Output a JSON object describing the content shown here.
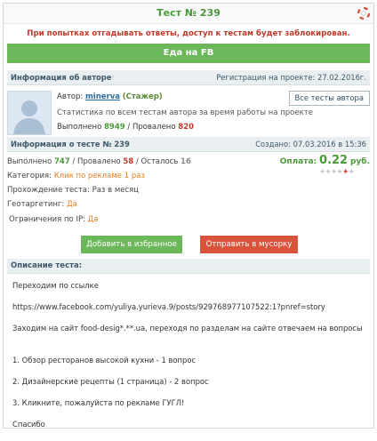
{
  "title": "Тест № 239",
  "warning": "При попытках отгадывать ответы, доступ к тестам будет заблокирован.",
  "fb_button": "Еда на FB",
  "author_section": {
    "label": "Информация об авторе",
    "reg_prefix": "Регистрация на проекте:",
    "reg_date": "27.02.2016г."
  },
  "author": {
    "prefix": "Автор:",
    "name": "minerva",
    "status": "(Стажер)",
    "all_tests_button": "Все тесты автора",
    "stats_text": "Статистика по всем тестам автора за время работы на проекте",
    "done_label": "Выполнено",
    "done_value": "8949",
    "sep": "/",
    "failed_label": "Провалено",
    "failed_value": "820"
  },
  "test_section": {
    "label": "Информация о тесте № 239",
    "created_prefix": "Создано:",
    "created_date": "07.03.2016 в 15:36"
  },
  "test": {
    "done_label": "Выполнено",
    "done_value": "747",
    "failed_label": "Провалено",
    "failed_value": "58",
    "left_label": "Осталось",
    "left_value": "16",
    "category_label": "Категория:",
    "category_value": "Клик по рекламе 1 раз",
    "pass_label": "Прохождение теста:",
    "pass_value": "Раз в месяц",
    "geo_label": "Геотаргетинг:",
    "geo_value": "Да",
    "ip_label": "Ограничения по IP:",
    "ip_value": "Да",
    "price_label": "Оплата:",
    "price_value": "0.22",
    "price_unit": "руб."
  },
  "actions": {
    "favorite": "Добавить в избранное",
    "trash": "Отправить в мусорку"
  },
  "description": {
    "label": "Описание теста:",
    "lines": [
      "Переходим по ссылке",
      "https://www.facebook.com/yuliya.yurieva.9/posts/929768977107522:1?pnref=story",
      "Заходим на сайт food-desig*.**.ua, переходя по разделам на сайте отвечаем на вопросы",
      "",
      "1. Обзор ресторанов высокой кухни - 1 вопрос",
      "2. Дизайнерские рецепты (1 страница) - 2 вопрос",
      "3. Кликните, пожалуйста по рекламе ГУГЛ!",
      "Спасибо"
    ]
  },
  "colors": {
    "accent_green": "#6bb85a",
    "danger_red": "#d9533b",
    "link_blue": "#2b6c9e"
  },
  "icons": {
    "close": "lifebuoy-icon",
    "avatar": "default-avatar-icon",
    "stars": "rating-stars-icon"
  }
}
